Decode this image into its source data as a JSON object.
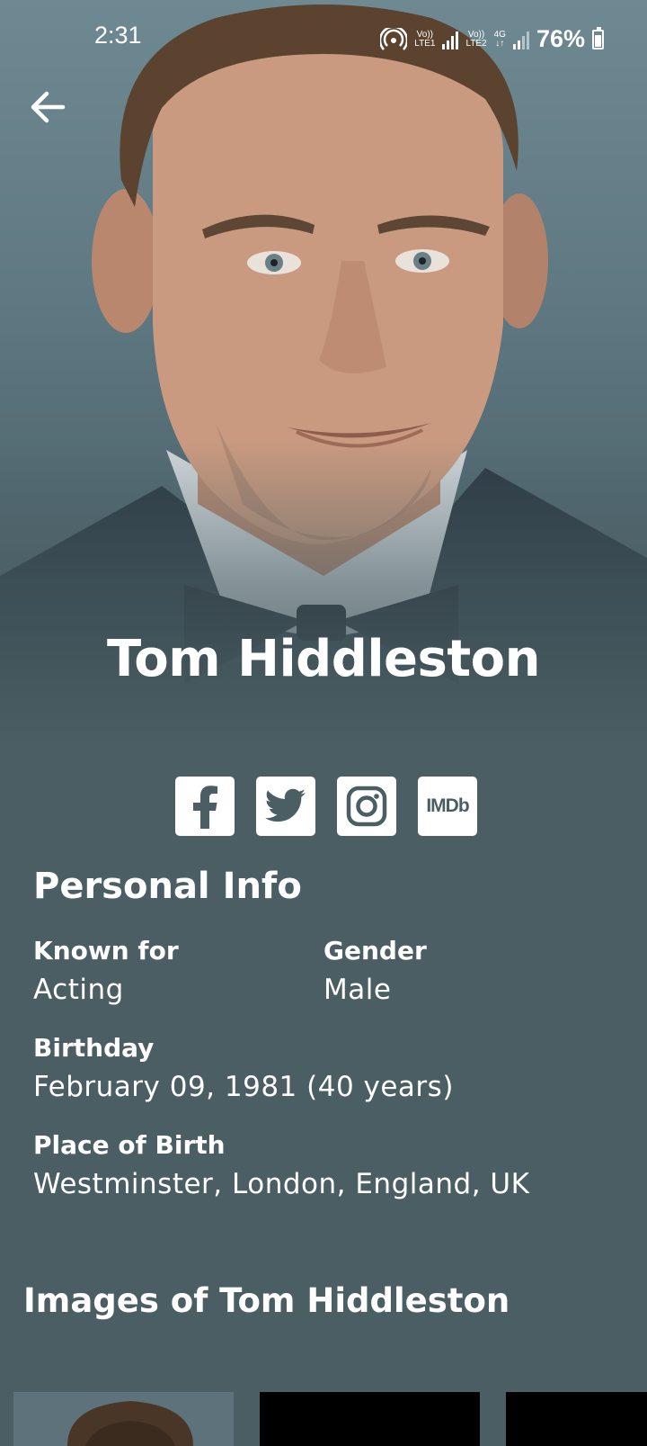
{
  "status_bar": {
    "time": "2:31",
    "sim1_tag_top": "Vo))",
    "sim1_tag_bottom": "LTE1",
    "sim2_tag_top": "Vo))",
    "sim2_tag_bottom": "LTE2",
    "network_type": "4G",
    "battery": "76%"
  },
  "person": {
    "name": "Tom Hiddleston"
  },
  "social": {
    "links": [
      "facebook",
      "twitter",
      "instagram",
      "imdb"
    ],
    "imdb_label": "IMDb"
  },
  "personal_info": {
    "title": "Personal Info",
    "known_for_label": "Known for",
    "known_for_value": "Acting",
    "gender_label": "Gender",
    "gender_value": "Male",
    "birthday_label": "Birthday",
    "birthday_value": "February 09, 1981 (40 years)",
    "place_label": "Place of Birth",
    "place_value": "Westminster, London, England, UK"
  },
  "images_section": {
    "title": "Images of Tom Hiddleston"
  },
  "colors": {
    "background": "#4a5e63",
    "text": "#ffffff"
  }
}
